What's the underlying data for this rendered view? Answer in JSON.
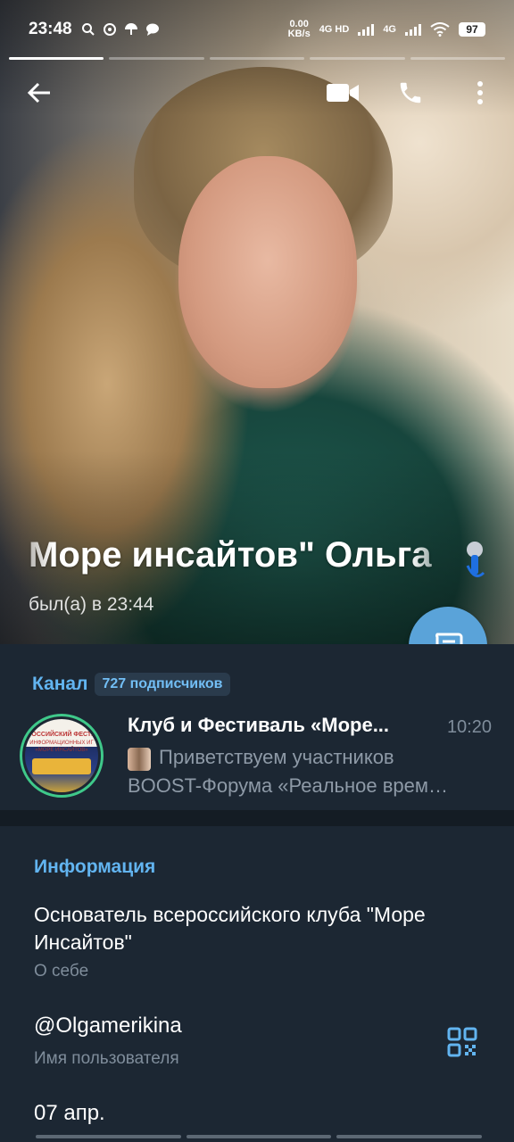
{
  "status_bar": {
    "time": "23:48",
    "net_speed_value": "0.00",
    "net_speed_unit": "KB/s",
    "net_type_1": "4G HD",
    "net_type_2": "4G",
    "battery": "97",
    "notification_icons": [
      "search-icon",
      "whatsapp-icon",
      "umbrella-icon",
      "chat-bubble-icon"
    ]
  },
  "toolbar": {
    "back_icon": "arrow-left-icon",
    "video_icon": "video-camera-icon",
    "call_icon": "phone-icon",
    "menu_icon": "more-vertical-icon"
  },
  "profile": {
    "name": "Море инсайтов\"    Ольга",
    "last_seen": "был(а) в 23:44",
    "story_segments": 5,
    "active_segment": 1
  },
  "channel": {
    "label": "Канал",
    "subscribers": "727 подписчиков",
    "title": "Клуб и Фестиваль «Море...",
    "time": "10:20",
    "preview_line1": "Приветствуем участников",
    "preview_line2": "BOOST-Форума «Реальное врем…",
    "avatar_text_1": "РОССИЙСКИЙ ФЕСТИ",
    "avatar_text_2": "ИНФОРМАЦИОННЫХ ИГ",
    "avatar_text_3": "«МОРЕ ИНСАЙТОВ»"
  },
  "info": {
    "title": "Информация",
    "bio": "Основатель всероссийского клуба \"Море Инсайтов\"",
    "bio_caption": "О себе",
    "username": "@Olgamerikina",
    "username_caption": "Имя пользователя",
    "birthday": "07 апр."
  },
  "colors": {
    "accent": "#62b4f0",
    "fab": "#5aa3d9",
    "background": "#1c2733",
    "divider": "#141c24",
    "secondary_text": "#7f8d9b",
    "story_ring": "#3fc98a"
  }
}
